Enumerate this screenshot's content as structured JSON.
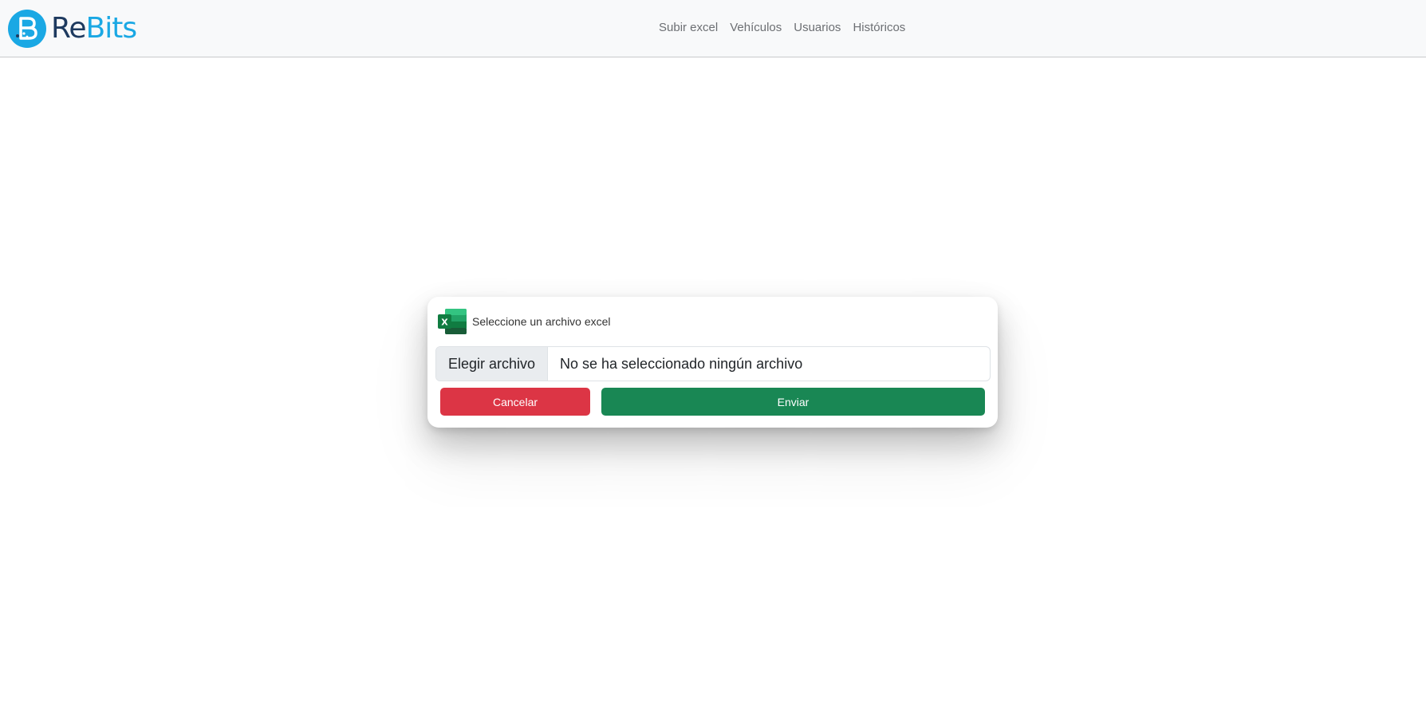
{
  "brand": {
    "name_part1": "Re",
    "name_part2": "Bits",
    "logo_letter": "B"
  },
  "nav": {
    "items": [
      {
        "label": "Subir excel"
      },
      {
        "label": "Vehículos"
      },
      {
        "label": "Usuarios"
      },
      {
        "label": "Históricos"
      }
    ]
  },
  "upload_card": {
    "title": "Seleccione un archivo excel",
    "icon": "excel-icon",
    "file_button_label": "Elegir archivo",
    "file_status": "No se ha seleccionado ningún archivo",
    "cancel_label": "Cancelar",
    "send_label": "Enviar"
  },
  "colors": {
    "brand_blue": "#1aa8e4",
    "brand_navy": "#1e3a5f",
    "cancel": "#dc3545",
    "send": "#198754",
    "excel_green": "#107c41"
  }
}
